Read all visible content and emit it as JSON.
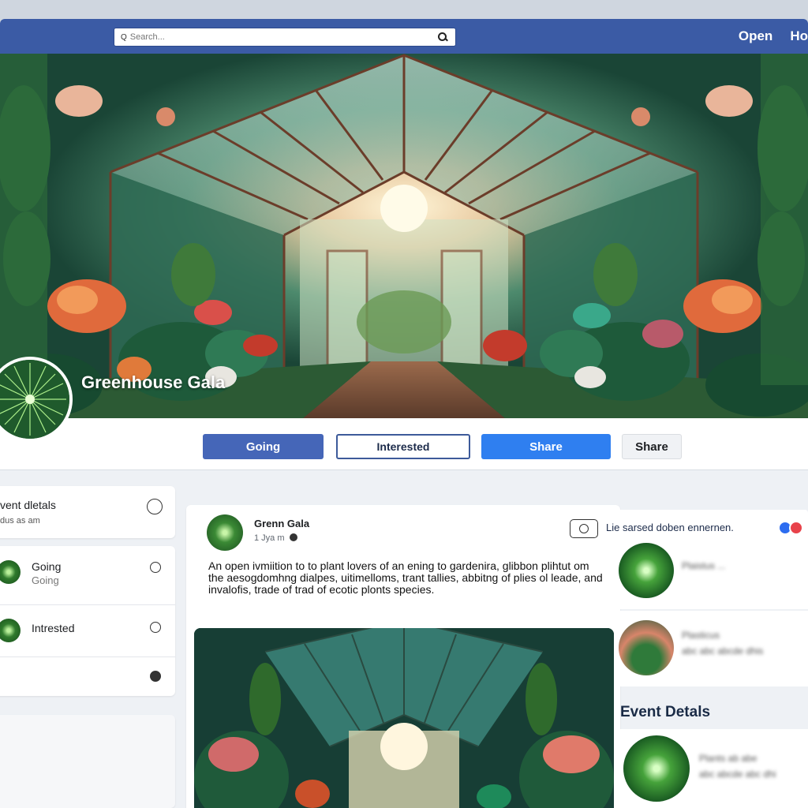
{
  "topbar": {
    "search_lead": "Q",
    "search_placeholder": "Search...",
    "nav": [
      "Open",
      "Ho"
    ]
  },
  "hero": {
    "title": "Greenhouse Gala"
  },
  "actions": {
    "going": "Going",
    "interested": "Interested",
    "share_primary": "Share",
    "share_secondary": "Share"
  },
  "left": {
    "head_title": "vent dletals",
    "head_sub": "dus as am",
    "items": [
      {
        "label": "Going",
        "sub": "Going"
      },
      {
        "label": "Intrested",
        "sub": ""
      }
    ]
  },
  "post": {
    "name": "Grenn Gala",
    "time": "1 Jya m",
    "body": "An open ivmiition to to plant lovers of an ening to gardenira, glibbon plihtut om the aesogdomhng dialpes, uitimelloms, trant tallies, abbitng of plies ol leade, and invalofis, trade of trad of ecotic plonts species."
  },
  "right": {
    "notice": "Lie sarsed doben ennernen.",
    "card1_blur": "Plaistus ...",
    "card2_blur_1": "Plasticus",
    "card2_blur_2": "abc abc abcde dhis",
    "heading": "Event Detals",
    "card3_blur_1": "Plants ab abe",
    "card3_blur_2": "abc abcde abc dhi"
  },
  "colors": {
    "topbar": "#3b5ba5",
    "going": "#4566b8",
    "share": "#2f7ff0"
  }
}
